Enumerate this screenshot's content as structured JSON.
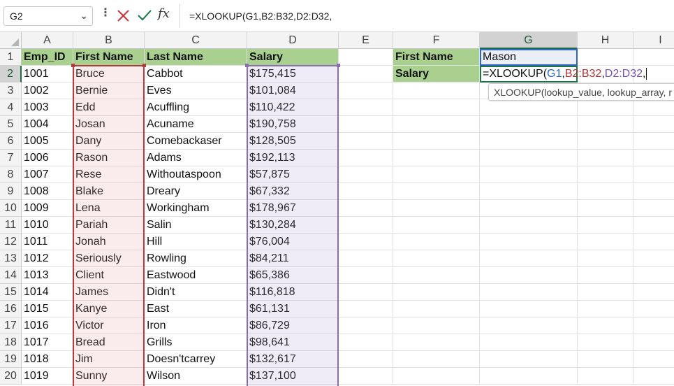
{
  "formula_bar": {
    "name_box": "G2",
    "formula": "=XLOOKUP(G1,B2:B32,D2:D32,"
  },
  "columns": [
    "A",
    "B",
    "C",
    "D",
    "E",
    "F",
    "G",
    "H",
    "I"
  ],
  "table": {
    "headers": [
      "Emp_ID",
      "First Name",
      "Last Name",
      "Salary"
    ],
    "rows": [
      [
        "1001",
        "Bruce",
        "Cabbot",
        "$175,415"
      ],
      [
        "1002",
        "Bernie",
        "Eves",
        "$101,084"
      ],
      [
        "1003",
        "Edd",
        "Acuffling",
        "$110,422"
      ],
      [
        "1004",
        "Josan",
        "Acuname",
        "$190,758"
      ],
      [
        "1005",
        "Dany",
        "Comebackaser",
        "$128,505"
      ],
      [
        "1006",
        "Rason",
        "Adams",
        "$192,113"
      ],
      [
        "1007",
        "Rese",
        "Withoutaspoon",
        "$57,875"
      ],
      [
        "1008",
        "Blake",
        "Dreary",
        "$67,332"
      ],
      [
        "1009",
        "Lena",
        "Workingham",
        "$178,967"
      ],
      [
        "1010",
        "Pariah",
        "Salin",
        "$130,284"
      ],
      [
        "1011",
        "Jonah",
        "Hill",
        "$76,004"
      ],
      [
        "1012",
        "Seriously",
        "Rowling",
        "$84,211"
      ],
      [
        "1013",
        "Client",
        "Eastwood",
        "$65,386"
      ],
      [
        "1014",
        "James",
        "Didn't",
        "$116,818"
      ],
      [
        "1015",
        "Kanye",
        "East",
        "$61,131"
      ],
      [
        "1016",
        "Victor",
        "Iron",
        "$86,729"
      ],
      [
        "1017",
        "Bread",
        "Grills",
        "$98,641"
      ],
      [
        "1018",
        "Jim",
        "Doesn'tcarrey",
        "$132,617"
      ],
      [
        "1019",
        "Sunny",
        "Wilson",
        "$137,100"
      ]
    ]
  },
  "lookup": {
    "first_name_label": "First Name",
    "first_name_value": "Mason",
    "salary_label": "Salary",
    "formula_parts": {
      "prefix": "=XLOOKUP(",
      "ref_lookup": "G1",
      "sep1": ",",
      "ref_array": "B2:B32",
      "sep2": ",",
      "ref_return": "D2:D32",
      "sep3": ","
    }
  },
  "tooltip": "XLOOKUP(lookup_value, lookup_array, r",
  "colors": {
    "header_fill": "#a9d08e",
    "ref_lookup": "#2f64c8",
    "ref_array": "#b03232",
    "ref_return": "#7b4fb0",
    "selection": "#217346"
  }
}
